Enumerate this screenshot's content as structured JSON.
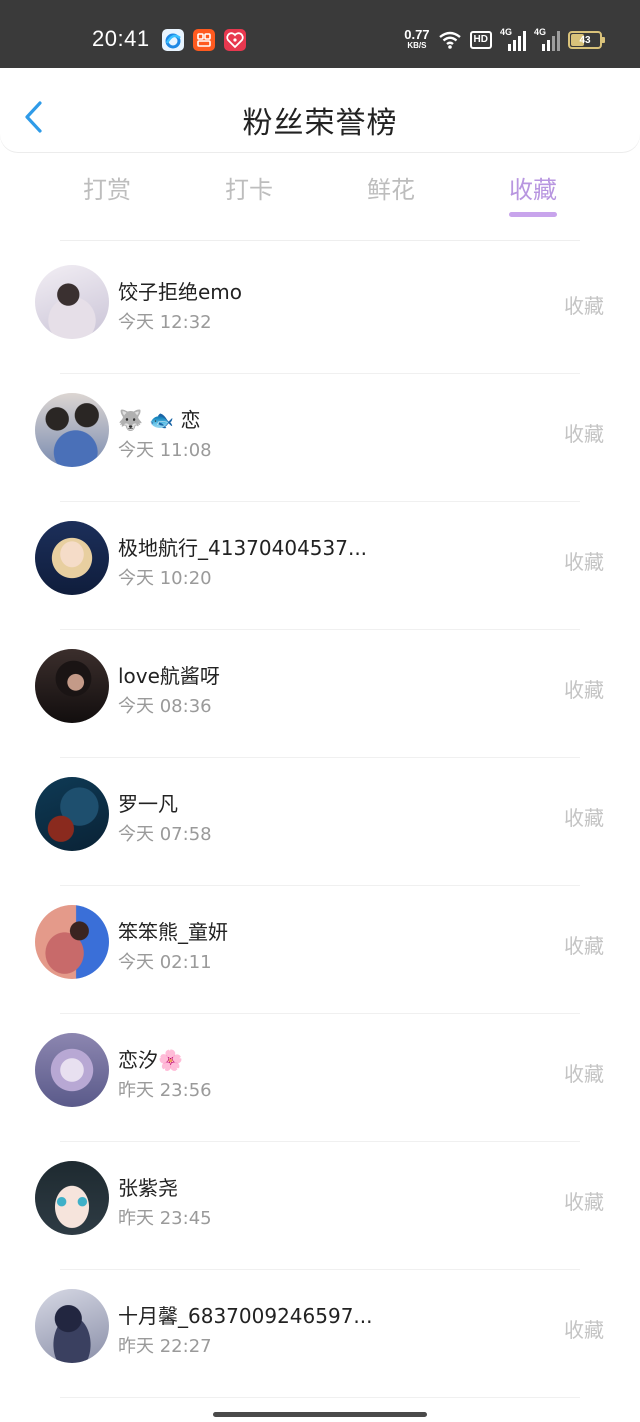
{
  "status_bar": {
    "time": "20:41",
    "net_speed": "0.77",
    "net_unit": "KB/S",
    "hd_label": "HD",
    "signal_label_1": "4G",
    "signal_label_2": "4G",
    "battery": "43",
    "icons": [
      "browser-app-icon",
      "taobao-app-icon",
      "heart-app-icon",
      "wifi-icon",
      "signal-icon",
      "battery-icon"
    ]
  },
  "header": {
    "title": "粉丝荣誉榜",
    "back_icon": "chevron-left-icon"
  },
  "tabs": [
    {
      "label": "打赏",
      "active": false
    },
    {
      "label": "打卡",
      "active": false
    },
    {
      "label": "鲜花",
      "active": false
    },
    {
      "label": "收藏",
      "active": true
    }
  ],
  "colors": {
    "accent": "#b896e0",
    "back_icon": "#2f9be8"
  },
  "fans": [
    {
      "name": "饺子拒绝emo",
      "time": "今天 12:32",
      "action": "收藏"
    },
    {
      "name": "🐺 🐟 恋",
      "time": "今天 11:08",
      "action": "收藏"
    },
    {
      "name": "极地航行_41370404537...",
      "time": "今天 10:20",
      "action": "收藏"
    },
    {
      "name": "love航酱呀",
      "time": "今天 08:36",
      "action": "收藏"
    },
    {
      "name": "罗一凡",
      "time": "今天 07:58",
      "action": "收藏"
    },
    {
      "name": "笨笨熊_童妍",
      "time": "今天 02:11",
      "action": "收藏"
    },
    {
      "name": "恋汐🌸",
      "time": "昨天 23:56",
      "action": "收藏"
    },
    {
      "name": "张紫尧",
      "time": "昨天 23:45",
      "action": "收藏"
    },
    {
      "name": "十月馨_6837009246597...",
      "time": "昨天 22:27",
      "action": "收藏"
    }
  ]
}
